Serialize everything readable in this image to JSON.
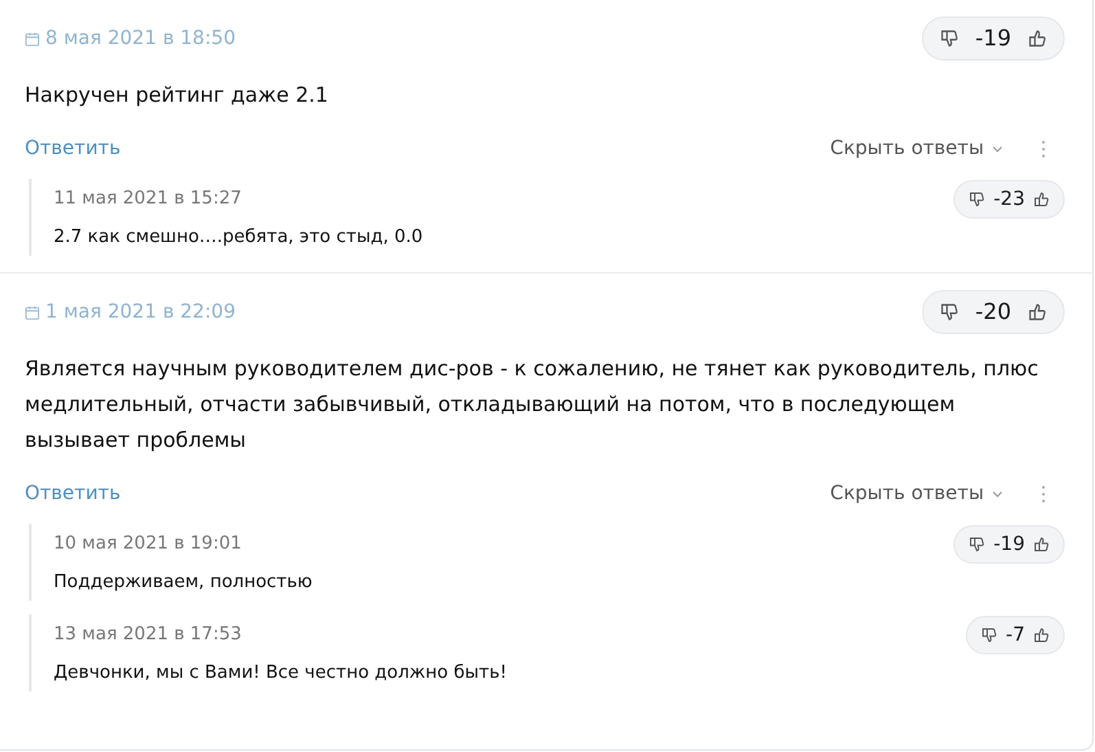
{
  "comments": [
    {
      "date": "8 мая 2021 в 18:50",
      "score": "-19",
      "text": "Накручен рейтинг даже 2.1",
      "reply_label": "Ответить",
      "toggle_label": "Скрыть ответы",
      "expanded": true,
      "replies": [
        {
          "date": "11 мая 2021 в 15:27",
          "score": "-23",
          "text": "2.7 как смешно….ребята, это стыд, 0.0"
        }
      ]
    },
    {
      "date": "1 мая 2021 в 22:09",
      "score": "-20",
      "text": "Является научным руководителем дис-ров - к сожалению, не тянет как руководитель, плюс медлительный, отчасти забывчивый, откладывающий на потом, что в последующем вызывает проблемы",
      "reply_label": "Ответить",
      "toggle_label": "Скрыть ответы",
      "expanded": true,
      "replies": [
        {
          "date": "10 мая 2021 в 19:01",
          "score": "-19",
          "text": "Поддерживаем, полностью"
        },
        {
          "date": "13 мая 2021 в 17:53",
          "score": "-7",
          "text": "Девчонки, мы с Вами! Все честно должно быть!"
        }
      ]
    }
  ]
}
